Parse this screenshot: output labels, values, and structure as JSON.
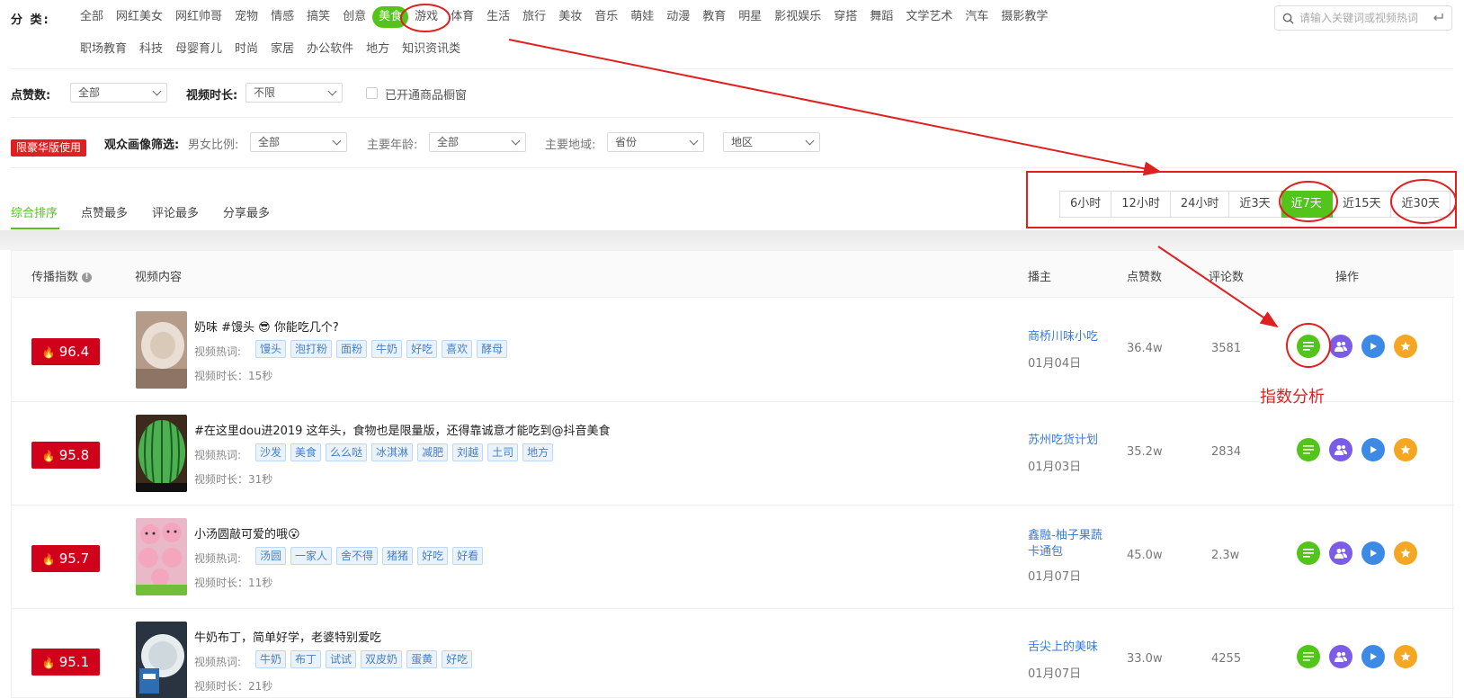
{
  "filters": {
    "category_label": "分  类:",
    "categories_row1": [
      "全部",
      "网红美女",
      "网红帅哥",
      "宠物",
      "情感",
      "搞笑",
      "创意",
      "美食",
      "游戏",
      "体育",
      "生活",
      "旅行",
      "美妆",
      "音乐",
      "萌娃",
      "动漫",
      "教育",
      "明星",
      "影视娱乐",
      "穿搭",
      "舞蹈",
      "文学艺术",
      "汽车",
      "摄影教学"
    ],
    "categories_row2": [
      "职场教育",
      "科技",
      "母婴育儿",
      "时尚",
      "家居",
      "办公软件",
      "地方",
      "知识资讯类"
    ],
    "active_category": "美食",
    "search_placeholder": "请输入关键词或视频热词",
    "likes_label": "点赞数:",
    "likes_value": "全部",
    "duration_label": "视频时长:",
    "duration_value": "不限",
    "showcase_checkbox": "已开通商品橱窗",
    "luxury_badge": "限豪华版使用",
    "audience_label": "观众画像筛选:",
    "gender_label": "男女比例:",
    "gender_value": "全部",
    "age_label": "主要年龄:",
    "age_value": "全部",
    "region_label": "主要地域:",
    "province_value": "省份",
    "area_value": "地区"
  },
  "sort_tabs": [
    "综合排序",
    "点赞最多",
    "评论最多",
    "分享最多"
  ],
  "time_ranges": [
    "6小时",
    "12小时",
    "24小时",
    "近3天",
    "近7天",
    "近15天",
    "近30天"
  ],
  "active_time_range": "近7天",
  "table": {
    "headers": {
      "index": "传播指数",
      "content": "视频内容",
      "author": "播主",
      "likes": "点赞数",
      "comments": "评论数",
      "ops": "操作"
    },
    "keywords_label": "视频热词:",
    "rows": [
      {
        "score": "96.4",
        "title": "奶味 #馒头 😎 你能吃几个?",
        "keywords": [
          "馒头",
          "泡打粉",
          "面粉",
          "牛奶",
          "好吃",
          "喜欢",
          "酵母"
        ],
        "duration": "视频时长：15秒",
        "author": "商桥川味小吃",
        "date": "01月04日",
        "likes": "36.4w",
        "comments": "3581"
      },
      {
        "score": "95.8",
        "title": "#在这里dou进2019 这年头，食物也是限量版，还得靠诚意才能吃到@抖音美食",
        "keywords": [
          "沙发",
          "美食",
          "么么哒",
          "冰淇淋",
          "减肥",
          "刘越",
          "土司",
          "地方"
        ],
        "duration": "视频时长：31秒",
        "author": "苏州吃货计划",
        "date": "01月03日",
        "likes": "35.2w",
        "comments": "2834"
      },
      {
        "score": "95.7",
        "title": "小汤圆敲可爱的哦😮",
        "keywords": [
          "汤圆",
          "一家人",
          "舍不得",
          "猪猪",
          "好吃",
          "好看"
        ],
        "duration": "视频时长：11秒",
        "author": "鑫融-柚子果蔬卡通包",
        "date": "01月07日",
        "likes": "45.0w",
        "comments": "2.3w"
      },
      {
        "score": "95.1",
        "title": "牛奶布丁，简单好学，老婆特别爱吃",
        "keywords": [
          "牛奶",
          "布丁",
          "试试",
          "双皮奶",
          "蛋黄",
          "好吃"
        ],
        "duration": "视频时长：21秒",
        "author": "舌尖上的美味",
        "date": "01月07日",
        "likes": "33.0w",
        "comments": "4255"
      }
    ]
  },
  "annotation": {
    "label": "指数分析",
    "color": "#e02020"
  },
  "colors": {
    "accent_green": "#52c41a",
    "score_red": "#d0021b",
    "link_blue": "#3a7bd5",
    "op_purple": "#7b5ce6",
    "op_blue": "#3d8ae6",
    "op_orange": "#f5a623"
  },
  "icons": {
    "search": "search-icon",
    "enter": "enter-icon",
    "flame": "flame-icon",
    "info": "info-icon",
    "ops": [
      "analysis-icon",
      "fans-icon",
      "play-icon",
      "star-icon"
    ]
  }
}
